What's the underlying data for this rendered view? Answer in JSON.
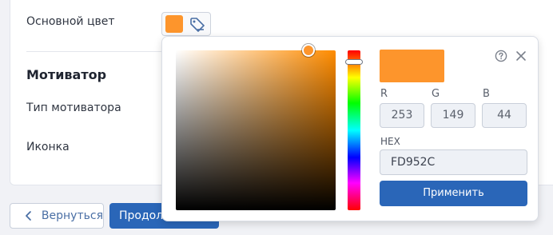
{
  "form": {
    "main_color_label": "Основной цвет",
    "motivator_title": "Мотиватор",
    "motivator_type_label": "Тип мотиватора",
    "icon_label": "Иконка"
  },
  "color_trigger": {
    "current_color": "#FD952C",
    "icon": "tag-edit-icon"
  },
  "actions": {
    "back_label": "Вернуться",
    "back_icon": "chevron-left-icon",
    "continue_label": "Продолжить"
  },
  "picker": {
    "hue_color": "#FF8C00",
    "preview_color": "#FD952C",
    "r_label": "R",
    "g_label": "G",
    "b_label": "B",
    "r_value": "253",
    "g_value": "149",
    "b_value": "44",
    "hex_label": "HEX",
    "hex_value": "FD952C",
    "apply_label": "Применить",
    "help_icon": "help-circle-icon",
    "close_icon": "close-icon"
  },
  "colors": {
    "accent": "#2A66B8",
    "page_bg": "#F1F2F6"
  }
}
